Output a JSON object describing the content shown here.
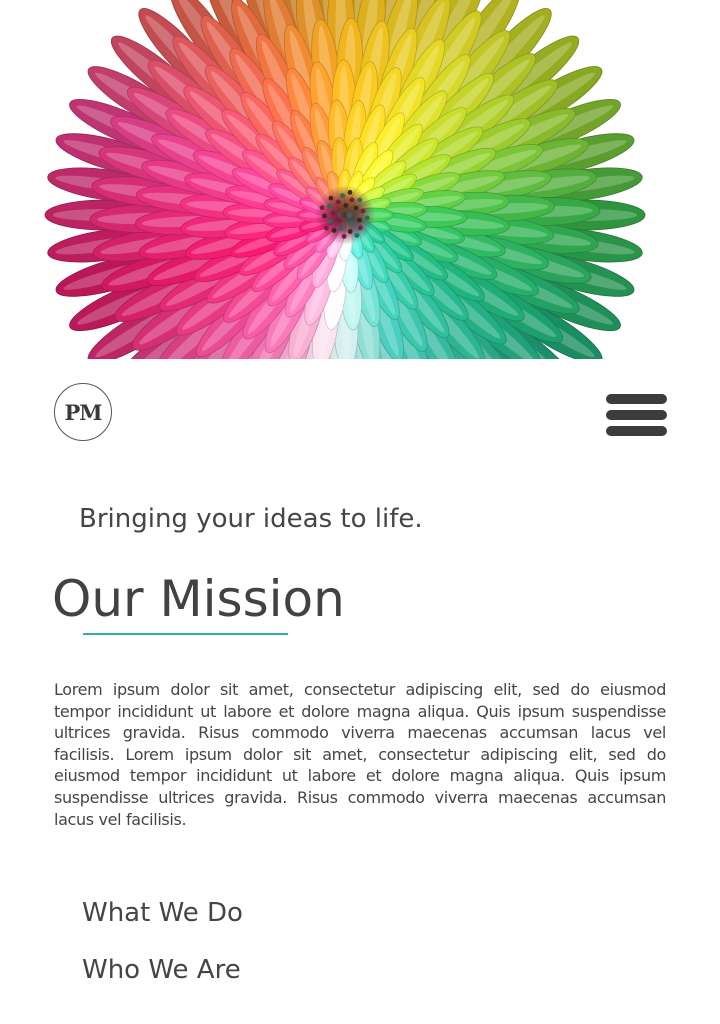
{
  "hero": {
    "image": "colorful-chrysanthemum-flower",
    "petal_colors": [
      "#f2177f",
      "#ff4fa8",
      "#ff7a2a",
      "#ffc21a",
      "#f2ea2a",
      "#a8dc2c",
      "#35b84a",
      "#18b37c",
      "#2ec8b6",
      "#ffffff"
    ]
  },
  "header": {
    "logo_text": "PM",
    "menu_icon": "hamburger-menu-icon"
  },
  "tagline": "Bringing your ideas to life.",
  "mission": {
    "title": "Our Mission",
    "accent_color": "#2fb0a3",
    "body": "Lorem ipsum dolor sit amet, consectetur adipiscing elit, sed do eiusmod tempor incididunt ut labore et dolore magna aliqua. Quis ipsum suspendisse ultrices gravida. Risus commodo viverra maecenas accumsan lacus vel facilisis. Lorem ipsum dolor sit amet, consectetur adipiscing elit, sed do eiusmod tempor incididunt ut labore et dolore magna aliqua. Quis ipsum suspendisse ultrices gravida. Risus commodo viverra maecenas accumsan lacus vel facilisis."
  },
  "nav": {
    "links": [
      "What We Do",
      "Who We Are"
    ]
  }
}
